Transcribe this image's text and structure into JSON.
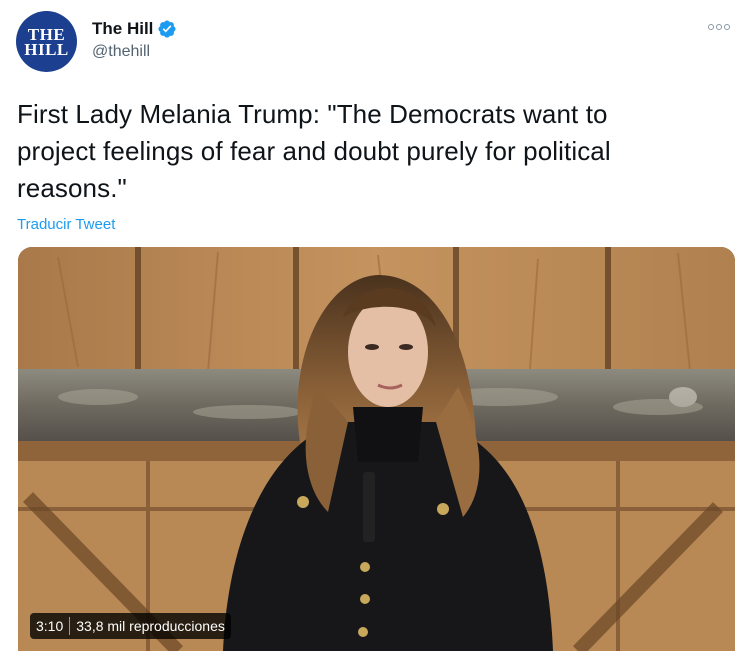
{
  "author": {
    "name": "The Hill",
    "handle": "@thehill",
    "avatar_text": [
      "THE",
      "HILL"
    ],
    "verified_icon": "verified-badge-icon",
    "verified_color": "#1d9bf0"
  },
  "tweet": {
    "text_lines": [
      "First Lady Melania Trump: \"The Democrats want to",
      "project feelings of fear and doubt purely for political",
      "reasons.\""
    ],
    "translate_label": "Traducir Tweet"
  },
  "media": {
    "duration": "3:10",
    "views": "33,8 mil reproducciones"
  },
  "menu_icon": "more-options-icon",
  "colors": {
    "link": "#1d9bf0",
    "avatar_bg": "#1d3f8f"
  }
}
